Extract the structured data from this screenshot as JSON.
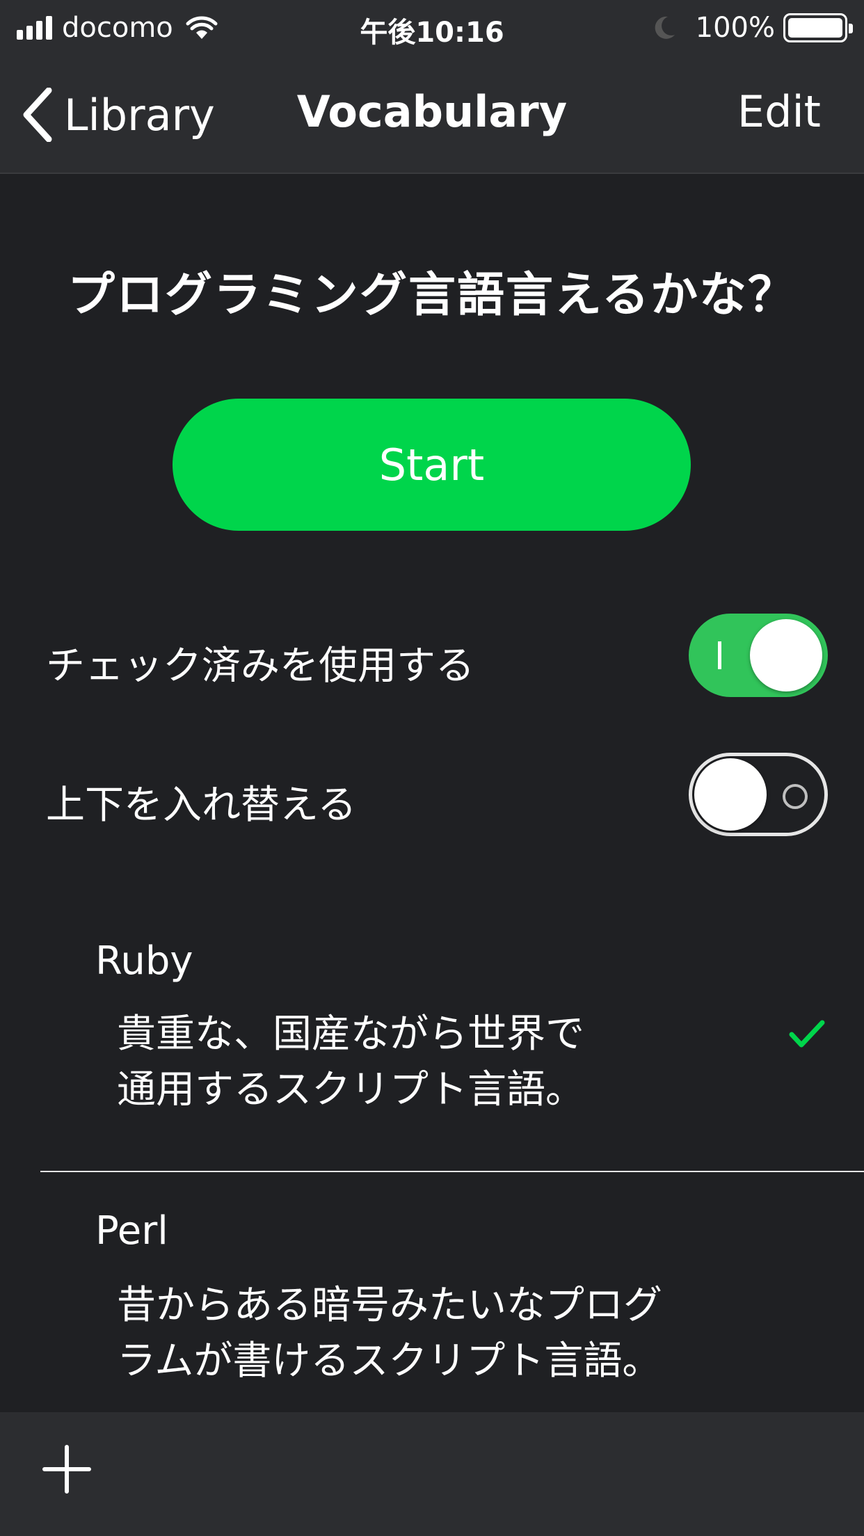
{
  "status_bar": {
    "carrier": "docomo",
    "time": "午後10:16",
    "battery": "100%",
    "icons": [
      "signal-icon",
      "wifi-icon",
      "moon-icon",
      "battery-icon"
    ]
  },
  "nav": {
    "back_label": "Library",
    "title": "Vocabulary",
    "edit_label": "Edit"
  },
  "set": {
    "title": "プログラミング言語言えるかな？",
    "start_label": "Start"
  },
  "settings": [
    {
      "label": "チェック済みを使用する",
      "enabled": true
    },
    {
      "label": "上下を入れ替える",
      "enabled": false
    }
  ],
  "cards": [
    {
      "term": "Ruby",
      "definition_lines": [
        "貴重な、国産ながら世界で",
        "通用するスクリプト言語。"
      ],
      "checked": true
    },
    {
      "term": "Perl",
      "definition_lines": [
        "昔からある暗号みたいなプログ",
        "ラムが書けるスクリプト言語。"
      ],
      "checked": false
    }
  ],
  "toolbar": {
    "add_icon": "plus-icon"
  },
  "colors": {
    "accent_green": "#00d54b",
    "toggle_green": "#31c45a",
    "background": "#1f2023",
    "bar": "#2c2d30"
  }
}
